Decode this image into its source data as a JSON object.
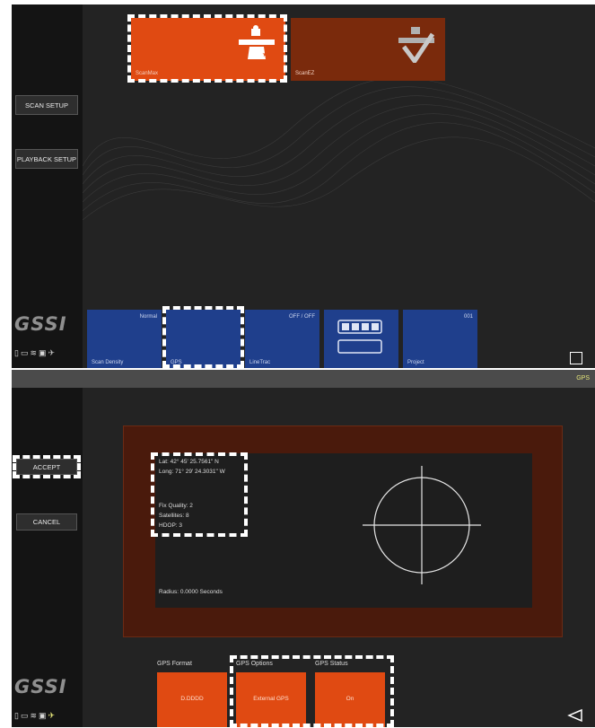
{
  "top": {
    "sidebar": {
      "scan_setup": "SCAN SETUP",
      "playback_setup": "PLAYBACK SETUP"
    },
    "modes": [
      {
        "label": "ScanMax",
        "icon": "surveyor-icon",
        "color": "#e04a12"
      },
      {
        "label": "ScanEZ",
        "icon": "checkmark-pipe-icon",
        "color": "#7a2a0c"
      }
    ],
    "bottom_tiles": [
      {
        "label": "Scan Density",
        "value": "Normal"
      },
      {
        "label": "GPS",
        "value": ""
      },
      {
        "label": "LineTrac",
        "value": "OFF / OFF"
      },
      {
        "label": "",
        "value": ""
      },
      {
        "label": "Project",
        "value": "001"
      }
    ],
    "logo": "GSSI"
  },
  "bottom": {
    "header_title": "GPS",
    "sidebar": {
      "accept": "ACCEPT",
      "cancel": "CANCEL"
    },
    "gps": {
      "lat": "Lat: 42° 45' 25.7561\" N",
      "long": "Long: 71° 29' 24.3031\" W",
      "fix_quality": "Fix Quality: 2",
      "satellites": "Satellites: 8",
      "hdop": "HDOP: 3",
      "radius": "Radius: 0.0000 Seconds"
    },
    "options": [
      {
        "label": "GPS Format",
        "value": "D.DDDD"
      },
      {
        "label": "GPS Options",
        "value": "External GPS"
      },
      {
        "label": "GPS Status",
        "value": "On"
      }
    ],
    "logo": "GSSI"
  },
  "colors": {
    "accent_orange": "#e04a12",
    "tile_blue": "#1f3f8c",
    "panel_bg": "#232323",
    "gps_title": "#e6e67a"
  }
}
